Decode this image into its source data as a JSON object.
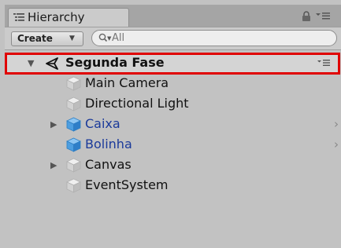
{
  "window": {
    "tab_label": "Hierarchy"
  },
  "toolbar": {
    "create_label": "Create",
    "search_placeholder": "All"
  },
  "scene": {
    "name": "Segunda Fase"
  },
  "objects": [
    {
      "label": "Main Camera",
      "type": "gameobject",
      "expandable": false
    },
    {
      "label": "Directional Light",
      "type": "gameobject",
      "expandable": false
    },
    {
      "label": "Caixa",
      "type": "prefab",
      "expandable": true
    },
    {
      "label": "Bolinha",
      "type": "prefab",
      "expandable": false
    },
    {
      "label": "Canvas",
      "type": "gameobject",
      "expandable": true
    },
    {
      "label": "EventSystem",
      "type": "gameobject",
      "expandable": false
    }
  ],
  "colors": {
    "highlight_border": "#e00000",
    "prefab_text": "#1b3a9a",
    "prefab_icon": "#3d8fd6"
  }
}
